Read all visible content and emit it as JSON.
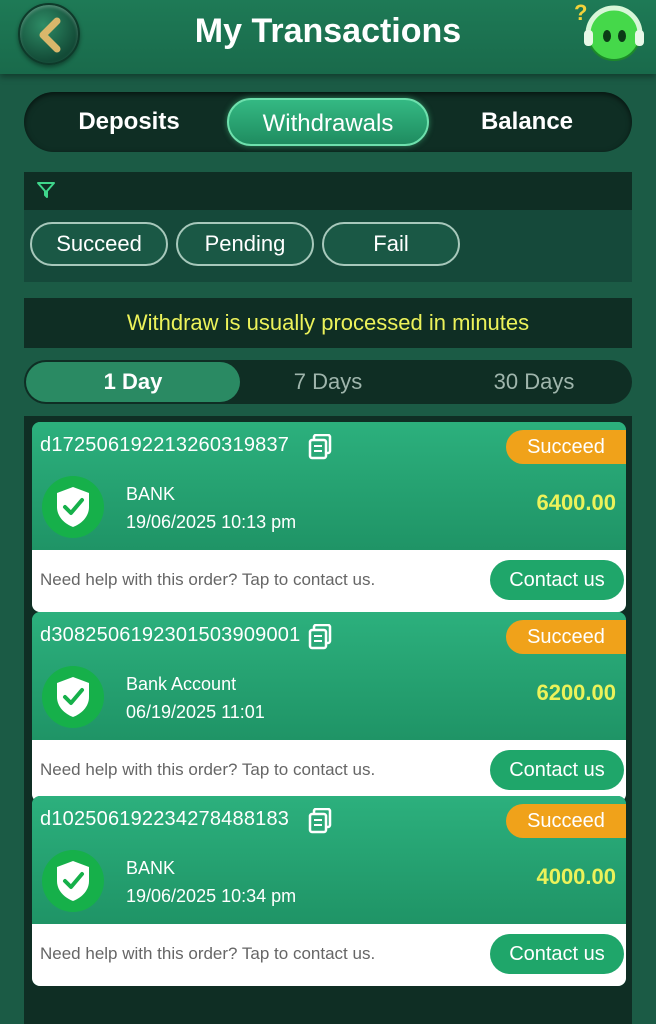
{
  "header": {
    "title": "My Transactions",
    "back_icon": "back-arrow-icon",
    "support_icon": "support-mascot-icon"
  },
  "main_tabs": [
    {
      "label": "Deposits",
      "active": false
    },
    {
      "label": "Withdrawals",
      "active": true
    },
    {
      "label": "Balance",
      "active": false
    }
  ],
  "filter": {
    "icon": "filter-icon",
    "statuses": [
      "Succeed",
      "Pending",
      "Fail"
    ]
  },
  "notice": "Withdraw is usually processed in minutes",
  "day_tabs": [
    {
      "label": "1 Day",
      "active": true
    },
    {
      "label": "7 Days",
      "active": false
    },
    {
      "label": "30 Days",
      "active": false
    }
  ],
  "transactions": [
    {
      "order_id": "d17250619221326031983​7",
      "status": "Succeed",
      "method": "BANK",
      "datetime": "19/06/2025 10:13 pm",
      "amount": "6400.00",
      "help": "Need help with this order? Tap to contact us.",
      "contact": "Contact us"
    },
    {
      "order_id": "d308250619230150390900​1",
      "status": "Succeed",
      "method": "Bank Account",
      "datetime": "06/19/2025 11:01",
      "amount": "6200.00",
      "help": "Need help with this order? Tap to contact us.",
      "contact": "Contact us"
    },
    {
      "order_id": "d102506192234278488183",
      "status": "Succeed",
      "method": "BANK",
      "datetime": "19/06/2025 10:34 pm",
      "amount": "4000.00",
      "help": "Need help with this order? Tap to contact us.",
      "contact": "Contact us"
    }
  ],
  "colors": {
    "background": "#1b5b45",
    "accent_green": "#2cb07d",
    "badge_orange": "#f0a21a",
    "amount_yellow": "#ecf25a"
  }
}
